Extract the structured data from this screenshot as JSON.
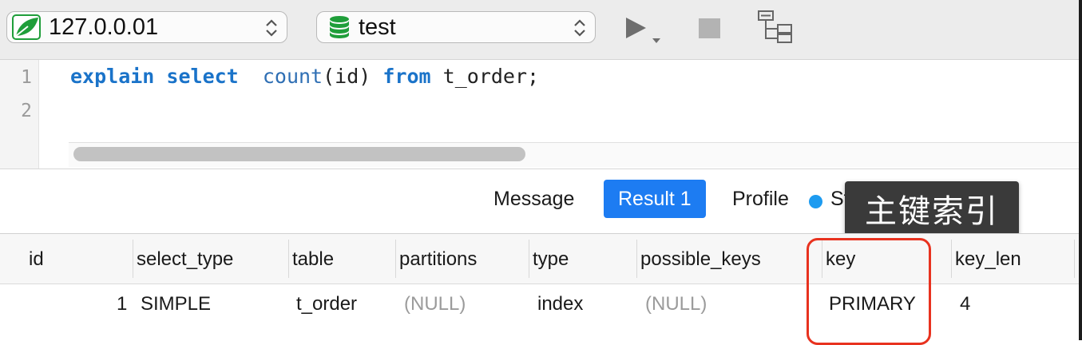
{
  "toolbar": {
    "connection": {
      "label": "127.0.0.01",
      "icon": "leaf-connection-icon"
    },
    "database": {
      "label": "test",
      "icon": "database-icon"
    },
    "run_icon": "play-icon",
    "stop_icon": "stop-icon",
    "explain_icon": "explain-tree-icon"
  },
  "editor": {
    "line_numbers": [
      "1",
      "2"
    ],
    "tokens": {
      "explain": "explain",
      "select": "select",
      "count": "count",
      "args": "(id)",
      "from": "from",
      "table": "t_order;"
    }
  },
  "tabs": {
    "message": "Message",
    "result": "Result 1",
    "profile": "Profile",
    "status": "Status"
  },
  "tooltip": "主键索引",
  "grid": {
    "headers": [
      "id",
      "select_type",
      "table",
      "partitions",
      "type",
      "possible_keys",
      "key",
      "key_len"
    ],
    "row": [
      "1",
      "SIMPLE",
      "t_order",
      "(NULL)",
      "index",
      "(NULL)",
      "PRIMARY",
      "4"
    ]
  },
  "colors": {
    "accent": "#1d7cf2",
    "keyword": "#1a73c9",
    "highlight": "#e8321f",
    "tooltip_bg": "#3a3a3a",
    "status_dot": "#1d9bf0",
    "db_icon": "#1f9e3a"
  }
}
